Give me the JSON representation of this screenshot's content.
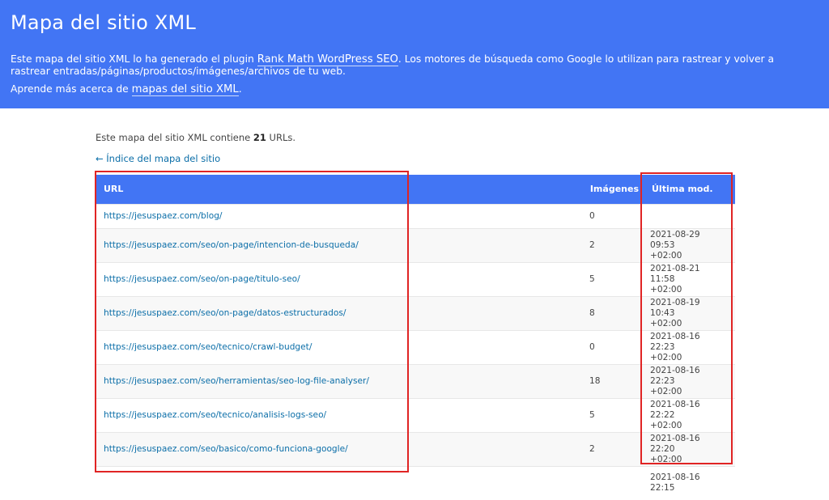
{
  "header": {
    "title": "Mapa del sitio XML",
    "desc_before": "Este mapa del sitio XML lo ha generado el plugin ",
    "plugin_link": "Rank Math WordPress SEO",
    "desc_after": ". Los motores de búsqueda como Google lo utilizan para rastrear y volver a rastrear entradas/páginas/productos/imágenes/archivos de tu web.",
    "learn_before": "Aprende más acerca de ",
    "learn_link": "mapas del sitio XML",
    "learn_after": ".",
    "bg_color": "#4275f4"
  },
  "summary": {
    "count_before": "Este mapa del sitio XML contiene ",
    "count_value": "21",
    "count_after": " URLs."
  },
  "back_link": "← Índice del mapa del sitio",
  "table": {
    "headers": {
      "url": "URL",
      "images": "Imágenes",
      "lastmod": "Última mod."
    },
    "rows": [
      {
        "url": "https://jesuspaez.com/blog/",
        "images": "0",
        "date": "",
        "tz": ""
      },
      {
        "url": "https://jesuspaez.com/seo/on-page/intencion-de-busqueda/",
        "images": "2",
        "date": "2021-08-29 09:53",
        "tz": "+02:00"
      },
      {
        "url": "https://jesuspaez.com/seo/on-page/titulo-seo/",
        "images": "5",
        "date": "2021-08-21 11:58",
        "tz": "+02:00"
      },
      {
        "url": "https://jesuspaez.com/seo/on-page/datos-estructurados/",
        "images": "8",
        "date": "2021-08-19 10:43",
        "tz": "+02:00"
      },
      {
        "url": "https://jesuspaez.com/seo/tecnico/crawl-budget/",
        "images": "0",
        "date": "2021-08-16 22:23",
        "tz": "+02:00"
      },
      {
        "url": "https://jesuspaez.com/seo/herramientas/seo-log-file-analyser/",
        "images": "18",
        "date": "2021-08-16 22:23",
        "tz": "+02:00"
      },
      {
        "url": "https://jesuspaez.com/seo/tecnico/analisis-logs-seo/",
        "images": "5",
        "date": "2021-08-16 22:22",
        "tz": "+02:00"
      },
      {
        "url": "https://jesuspaez.com/seo/basico/como-funciona-google/",
        "images": "2",
        "date": "2021-08-16 22:20",
        "tz": "+02:00"
      },
      {
        "url": "",
        "images": "",
        "date": "2021-08-16 22:15",
        "tz": ""
      }
    ]
  },
  "highlight_color": "#e02424"
}
